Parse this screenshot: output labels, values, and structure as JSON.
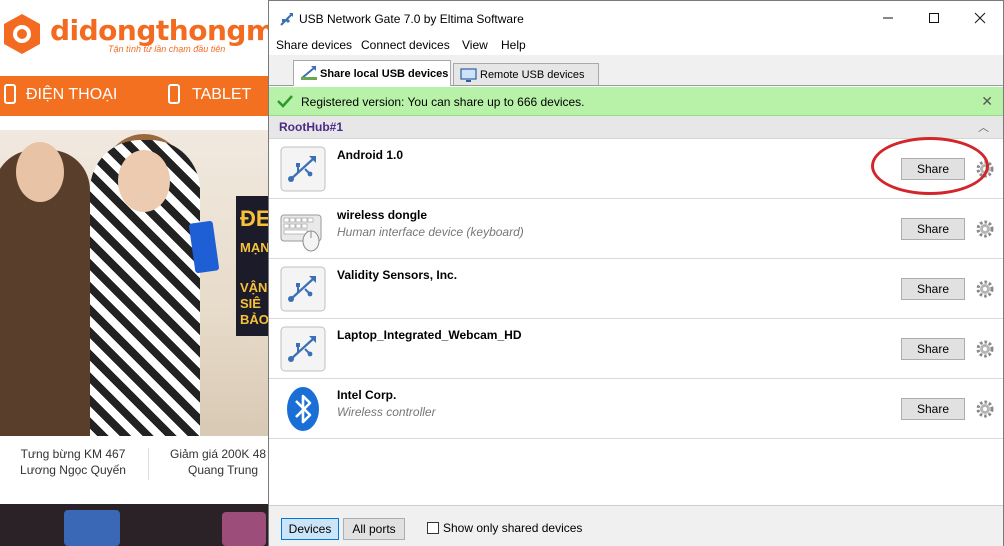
{
  "website": {
    "logo_text": "didongthongminh",
    "slogan": "Tận tình từ lần chạm đầu tiên",
    "nav": [
      "ĐIỆN THOẠI",
      "TABLET"
    ],
    "hero_banner": [
      "ĐE",
      "MẠN",
      "VẬN",
      "SIÊ",
      "BẢO"
    ],
    "promos": [
      {
        "line1": "Tưng bừng KM 467",
        "line2": "Lương Ngọc Quyến"
      },
      {
        "line1": "Giảm giá 200K 48",
        "line2": "Quang Trung"
      }
    ]
  },
  "window": {
    "title": "USB Network Gate 7.0 by Eltima Software",
    "controls": {
      "minimize": "—",
      "maximize": "☐",
      "close": "✕"
    }
  },
  "menu": [
    "Share devices",
    "Connect devices",
    "View",
    "Help"
  ],
  "tabs": [
    {
      "label": "Share local USB devices",
      "active": true
    },
    {
      "label": "Remote USB devices",
      "active": false
    }
  ],
  "notice": {
    "text": "Registered version: You can share up to 666 devices.",
    "close": "✕",
    "color": "#b8f2a8"
  },
  "hub": {
    "title": "RootHub#1",
    "collapse": "︿"
  },
  "devices": [
    {
      "name": "Android 1.0",
      "desc": "",
      "icon": "usb-icon",
      "button": "Share"
    },
    {
      "name": "wireless dongle",
      "desc": "Human interface device (keyboard)",
      "icon": "keyboard-mouse-icon",
      "button": "Share"
    },
    {
      "name": "Validity Sensors, Inc.",
      "desc": "",
      "icon": "usb-icon",
      "button": "Share"
    },
    {
      "name": "Laptop_Integrated_Webcam_HD",
      "desc": "",
      "icon": "usb-icon",
      "button": "Share"
    },
    {
      "name": "Intel Corp.",
      "desc": "Wireless controller",
      "icon": "bluetooth-icon",
      "button": "Share"
    }
  ],
  "bottom": {
    "devices_btn": "Devices",
    "ports_btn": "All ports",
    "show_only_shared": "Show only shared devices",
    "show_only_shared_checked": false
  },
  "annotation_color": "#d2262b"
}
